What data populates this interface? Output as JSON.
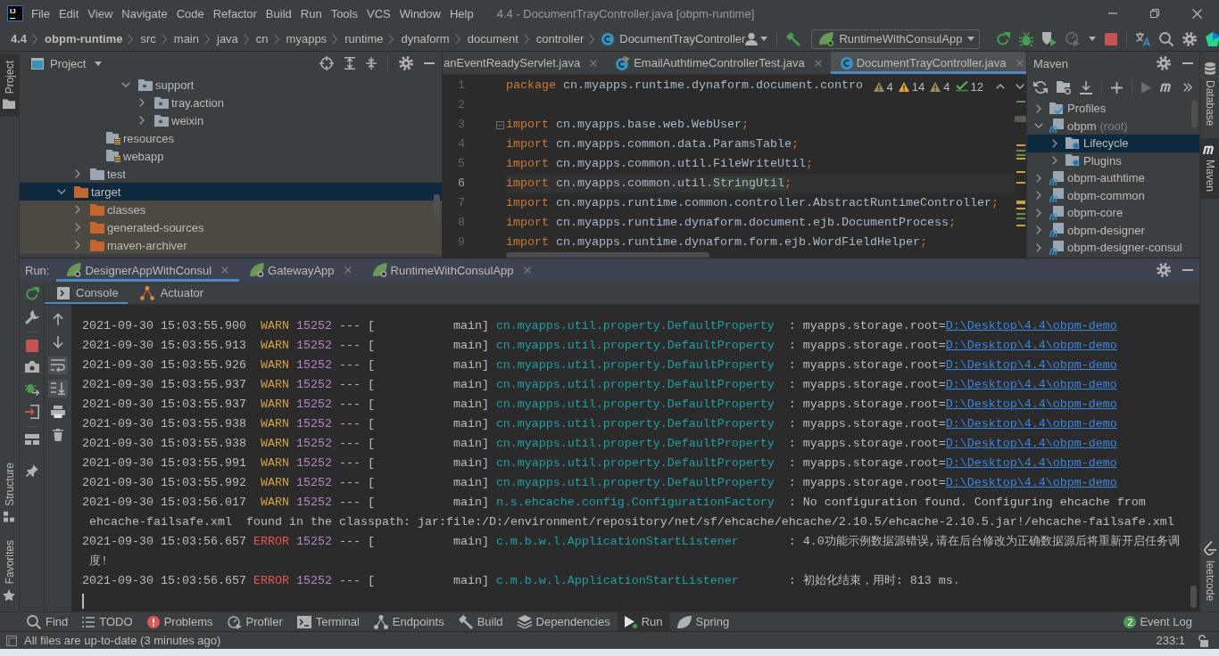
{
  "window": {
    "logo": "IJ",
    "title": "4.4 - DocumentTrayController.java [obpm-runtime]"
  },
  "menu": [
    "File",
    "Edit",
    "View",
    "Navigate",
    "Code",
    "Refactor",
    "Build",
    "Run",
    "Tools",
    "VCS",
    "Window",
    "Help"
  ],
  "breadcrumbs": [
    {
      "label": "4.4",
      "kind": "project"
    },
    {
      "label": "obpm-runtime",
      "kind": "module"
    },
    {
      "label": "src",
      "kind": "folder"
    },
    {
      "label": "main",
      "kind": "folder"
    },
    {
      "label": "java",
      "kind": "folder"
    },
    {
      "label": "cn",
      "kind": "folder"
    },
    {
      "label": "myapps",
      "kind": "folder"
    },
    {
      "label": "runtime",
      "kind": "folder"
    },
    {
      "label": "dynaform",
      "kind": "folder"
    },
    {
      "label": "document",
      "kind": "folder"
    },
    {
      "label": "controller",
      "kind": "folder"
    },
    {
      "label": "DocumentTrayController",
      "kind": "class"
    }
  ],
  "toolbar": {
    "run_configuration": "RuntimeWithConsulApp",
    "actions": [
      {
        "kind": "rerun",
        "disabled": false
      },
      {
        "kind": "debug",
        "disabled": false
      },
      {
        "kind": "coverage",
        "disabled": false
      },
      {
        "kind": "profile",
        "disabled": true
      },
      {
        "kind": "more",
        "disabled": false
      },
      {
        "kind": "stop",
        "disabled": false
      }
    ]
  },
  "left_stripe": {
    "top": [
      {
        "label": "Project",
        "kind": "project",
        "selected": true
      }
    ],
    "bottom": [
      {
        "label": "Structure",
        "kind": "structure",
        "selected": false
      },
      {
        "label": "Favorites",
        "kind": "favorites",
        "selected": false
      }
    ]
  },
  "project_panel": {
    "title": "Project",
    "tree": [
      [
        [
          [
            [
              {
                "label": "support",
                "kind": "package",
                "expanded": true,
                "selected": false,
                "children": [
                  {
                    "label": "tray.action",
                    "kind": "package",
                    "expanded": false,
                    "selected": false
                  },
                  {
                    "label": "weixin",
                    "kind": "package",
                    "expanded": false,
                    "selected": false
                  }
                ]
              }
            ]
          ],
          {
            "label": "resources",
            "kind": "resources",
            "selected": false
          },
          {
            "label": "webapp",
            "kind": "resources",
            "selected": false
          }
        ],
        {
          "label": "test",
          "kind": "folder",
          "expanded": false,
          "selected": false
        }
      ],
      {
        "label": "target",
        "kind": "excluded",
        "expanded": true,
        "selected": true,
        "children": [
          {
            "label": "classes",
            "kind": "excluded",
            "expanded": false,
            "selected": false
          },
          {
            "label": "generated-sources",
            "kind": "excluded",
            "expanded": false,
            "selected": false
          },
          {
            "label": "maven-archiver",
            "kind": "excluded",
            "expanded": false,
            "selected": false
          }
        ]
      }
    ]
  },
  "editor": {
    "tabs": [
      {
        "label": "anEventReadyServlet.java",
        "kind": "plain",
        "selected": false
      },
      {
        "label": "EmailAuthtimeControllerTest.java",
        "kind": "test-class",
        "selected": false
      },
      {
        "label": "DocumentTrayController.java",
        "kind": "class",
        "selected": true
      }
    ],
    "inspections": [
      {
        "kind": "weak-warning",
        "count": "4"
      },
      {
        "kind": "warning",
        "count": "14"
      },
      {
        "kind": "weak-warning",
        "count": "4"
      },
      {
        "kind": "typo",
        "count": "12"
      }
    ],
    "lines": [
      {
        "number": "1",
        "current": false,
        "fold": false,
        "tokens": [
          {
            "kind": "keyword",
            "text": "package"
          },
          {
            "kind": "plain",
            "text": " cn.myapps.runtime.dynaform.document.contro"
          }
        ]
      },
      {
        "number": "2",
        "current": false,
        "fold": false
      },
      {
        "number": "3",
        "current": false,
        "fold": true,
        "tokens": [
          {
            "kind": "keyword",
            "text": "import"
          },
          {
            "kind": "plain",
            "text": " cn.myapps.base.web.WebUser"
          },
          {
            "kind": "keyword",
            "text": ";"
          }
        ]
      },
      {
        "number": "4",
        "current": false,
        "fold": false,
        "tokens": [
          {
            "kind": "keyword",
            "text": "import"
          },
          {
            "kind": "plain",
            "text": " cn.myapps.common.data.ParamsTable"
          },
          {
            "kind": "keyword",
            "text": ";"
          }
        ]
      },
      {
        "number": "5",
        "current": false,
        "fold": false,
        "tokens": [
          {
            "kind": "keyword",
            "text": "import"
          },
          {
            "kind": "plain",
            "text": " cn.myapps.common.util.FileWriteUtil"
          },
          {
            "kind": "keyword",
            "text": ";"
          }
        ]
      },
      {
        "number": "6",
        "current": true,
        "fold": false,
        "tokens": [
          {
            "kind": "keyword",
            "text": "import"
          },
          {
            "kind": "plain",
            "text": " cn.myapps.common.util."
          },
          {
            "kind": "highlight",
            "text": "StringUtil"
          },
          {
            "kind": "keyword",
            "text": ";"
          }
        ]
      },
      {
        "number": "7",
        "current": false,
        "fold": false,
        "tokens": [
          {
            "kind": "keyword",
            "text": "import"
          },
          {
            "kind": "plain",
            "text": " cn.myapps.runtime.common.controller.AbstractRuntimeController"
          },
          {
            "kind": "keyword",
            "text": ";"
          }
        ]
      },
      {
        "number": "8",
        "current": false,
        "fold": false,
        "tokens": [
          {
            "kind": "keyword",
            "text": "import"
          },
          {
            "kind": "plain",
            "text": " cn.myapps.runtime.dynaform.document.ejb.DocumentProcess"
          },
          {
            "kind": "keyword",
            "text": ";"
          }
        ]
      },
      {
        "number": "9",
        "current": false,
        "fold": false,
        "tokens": [
          {
            "kind": "keyword",
            "text": "import"
          },
          {
            "kind": "plain",
            "text": " cn.myapps.runtime.dynaform.form.ejb.WordFieldHelper"
          },
          {
            "kind": "keyword",
            "text": ";"
          }
        ]
      }
    ]
  },
  "maven_panel": {
    "title": "Maven",
    "toolbar": [
      {
        "kind": "reload",
        "disabled": false
      },
      {
        "kind": "generate",
        "disabled": false
      },
      {
        "kind": "download",
        "disabled": false
      },
      {
        "kind": "add",
        "disabled": false
      },
      {
        "kind": "run",
        "disabled": true
      },
      {
        "kind": "goal",
        "disabled": false
      },
      {
        "kind": "more",
        "disabled": false
      }
    ],
    "tree": [
      {
        "label": "Profiles",
        "kind": "profiles",
        "expanded": false,
        "selected": false
      },
      {
        "label": "obpm",
        "note": "(root)",
        "kind": "module",
        "expanded": true,
        "selected": false,
        "children": [
          {
            "label": "Lifecycle",
            "kind": "goals",
            "expanded": false,
            "selected": true
          },
          {
            "label": "Plugins",
            "kind": "goals",
            "expanded": false,
            "selected": false
          }
        ]
      },
      {
        "label": "obpm-authtime",
        "kind": "module",
        "expanded": false,
        "selected": false
      },
      {
        "label": "obpm-common",
        "kind": "module",
        "expanded": false,
        "selected": false
      },
      {
        "label": "obpm-core",
        "kind": "module",
        "expanded": false,
        "selected": false
      },
      {
        "label": "obpm-designer",
        "kind": "module",
        "expanded": false,
        "selected": false
      },
      {
        "label": "obpm-designer-consul",
        "kind": "module",
        "expanded": false,
        "selected": false
      }
    ]
  },
  "right_stripe": {
    "top": [
      {
        "label": "Database",
        "kind": "database",
        "selected": false
      },
      {
        "label": "Maven",
        "kind": "maven",
        "selected": true
      }
    ],
    "bottom": [
      {
        "label": "leetcode",
        "kind": "leetcode",
        "selected": false
      }
    ]
  },
  "run_panel": {
    "title": "Run:",
    "tabs": [
      {
        "label": "DesignerAppWithConsul",
        "selected": true
      },
      {
        "label": "GatewayApp",
        "selected": false
      },
      {
        "label": "RuntimeWithConsulApp",
        "selected": false
      }
    ],
    "subtabs": [
      {
        "label": "Console",
        "kind": "console",
        "selected": true
      },
      {
        "label": "Actuator",
        "kind": "actuator",
        "selected": false
      }
    ],
    "console_tools": [
      {
        "kind": "up",
        "on": false
      },
      {
        "kind": "down",
        "on": false
      },
      {
        "kind": "soft-wrap",
        "on": true
      },
      {
        "kind": "scroll-to-end",
        "on": true
      },
      {
        "kind": "print",
        "on": false
      },
      {
        "kind": "clear",
        "on": false
      }
    ],
    "console": [
      {
        "kind": "warn",
        "time": "2021-09-30 15:03:55.900",
        "level": "WARN",
        "pid": "15252",
        "sep": "--- [",
        "thread": "main]",
        "logger": "cn.myapps.util.property.DefaultProperty",
        "message": ": myapps.storage.root=",
        "link": "D:\\Desktop\\4.4\\obpm-demo"
      },
      {
        "kind": "warn",
        "time": "2021-09-30 15:03:55.913",
        "level": "WARN",
        "pid": "15252",
        "sep": "--- [",
        "thread": "main]",
        "logger": "cn.myapps.util.property.DefaultProperty",
        "message": ": myapps.storage.root=",
        "link": "D:\\Desktop\\4.4\\obpm-demo"
      },
      {
        "kind": "warn",
        "time": "2021-09-30 15:03:55.926",
        "level": "WARN",
        "pid": "15252",
        "sep": "--- [",
        "thread": "main]",
        "logger": "cn.myapps.util.property.DefaultProperty",
        "message": ": myapps.storage.root=",
        "link": "D:\\Desktop\\4.4\\obpm-demo"
      },
      {
        "kind": "warn",
        "time": "2021-09-30 15:03:55.937",
        "level": "WARN",
        "pid": "15252",
        "sep": "--- [",
        "thread": "main]",
        "logger": "cn.myapps.util.property.DefaultProperty",
        "message": ": myapps.storage.root=",
        "link": "D:\\Desktop\\4.4\\obpm-demo"
      },
      {
        "kind": "warn",
        "time": "2021-09-30 15:03:55.937",
        "level": "WARN",
        "pid": "15252",
        "sep": "--- [",
        "thread": "main]",
        "logger": "cn.myapps.util.property.DefaultProperty",
        "message": ": myapps.storage.root=",
        "link": "D:\\Desktop\\4.4\\obpm-demo"
      },
      {
        "kind": "warn",
        "time": "2021-09-30 15:03:55.938",
        "level": "WARN",
        "pid": "15252",
        "sep": "--- [",
        "thread": "main]",
        "logger": "cn.myapps.util.property.DefaultProperty",
        "message": ": myapps.storage.root=",
        "link": "D:\\Desktop\\4.4\\obpm-demo"
      },
      {
        "kind": "warn",
        "time": "2021-09-30 15:03:55.938",
        "level": "WARN",
        "pid": "15252",
        "sep": "--- [",
        "thread": "main]",
        "logger": "cn.myapps.util.property.DefaultProperty",
        "message": ": myapps.storage.root=",
        "link": "D:\\Desktop\\4.4\\obpm-demo"
      },
      {
        "kind": "warn",
        "time": "2021-09-30 15:03:55.991",
        "level": "WARN",
        "pid": "15252",
        "sep": "--- [",
        "thread": "main]",
        "logger": "cn.myapps.util.property.DefaultProperty",
        "message": ": myapps.storage.root=",
        "link": "D:\\Desktop\\4.4\\obpm-demo"
      },
      {
        "kind": "warn",
        "time": "2021-09-30 15:03:55.992",
        "level": "WARN",
        "pid": "15252",
        "sep": "--- [",
        "thread": "main]",
        "logger": "cn.myapps.util.property.DefaultProperty",
        "message": ": myapps.storage.root=",
        "link": "D:\\Desktop\\4.4\\obpm-demo"
      },
      {
        "kind": "warn",
        "time": "2021-09-30 15:03:56.017",
        "level": "WARN",
        "pid": "15252",
        "sep": "--- [",
        "thread": "main]",
        "logger": "n.s.ehcache.config.ConfigurationFactory",
        "message": ": No configuration found. Configuring ehcache from"
      },
      {
        "kind": "wrap",
        "message": "ehcache-failsafe.xml  found in the classpath: jar:file:/D:/environment/repository/net/sf/ehcache/ehcache/2.10.5/ehcache-2.10.5.jar!/ehcache-failsafe.xml"
      },
      {
        "kind": "error",
        "time": "2021-09-30 15:03:56.657",
        "level": "ERROR",
        "pid": "15252",
        "sep": "--- [",
        "thread": "main]",
        "logger": "c.m.b.w.l.ApplicationStartListener",
        "message": ": 4.0功能示例数据源错误,请在后台修改为正确数据源后将重新开启任务调"
      },
      {
        "kind": "wrap",
        "message": "度!"
      },
      {
        "kind": "error",
        "time": "2021-09-30 15:03:56.657",
        "level": "ERROR",
        "pid": "15252",
        "sep": "--- [",
        "thread": "main]",
        "logger": "c.m.b.w.l.ApplicationStartListener",
        "message": ": 初始化结束，用时: 813 ms."
      }
    ]
  },
  "bottom_tools": [
    {
      "label": "Find",
      "kind": "find",
      "selected": false
    },
    {
      "label": "TODO",
      "kind": "todo",
      "selected": false
    },
    {
      "label": "Problems",
      "kind": "problems",
      "selected": false
    },
    {
      "label": "Profiler",
      "kind": "profiler",
      "selected": false
    },
    {
      "label": "Terminal",
      "kind": "terminal",
      "selected": false
    },
    {
      "label": "Endpoints",
      "kind": "endpoints",
      "selected": false
    },
    {
      "label": "Build",
      "kind": "build",
      "selected": false
    },
    {
      "label": "Dependencies",
      "kind": "dependencies",
      "selected": false
    },
    {
      "label": "Run",
      "kind": "run",
      "selected": true
    },
    {
      "label": "Spring",
      "kind": "spring",
      "selected": false
    }
  ],
  "event_log": {
    "label": "Event Log",
    "badge": "2"
  },
  "status_bar": {
    "message": "All files are up-to-date (3 minutes ago)",
    "position": "233:1"
  }
}
